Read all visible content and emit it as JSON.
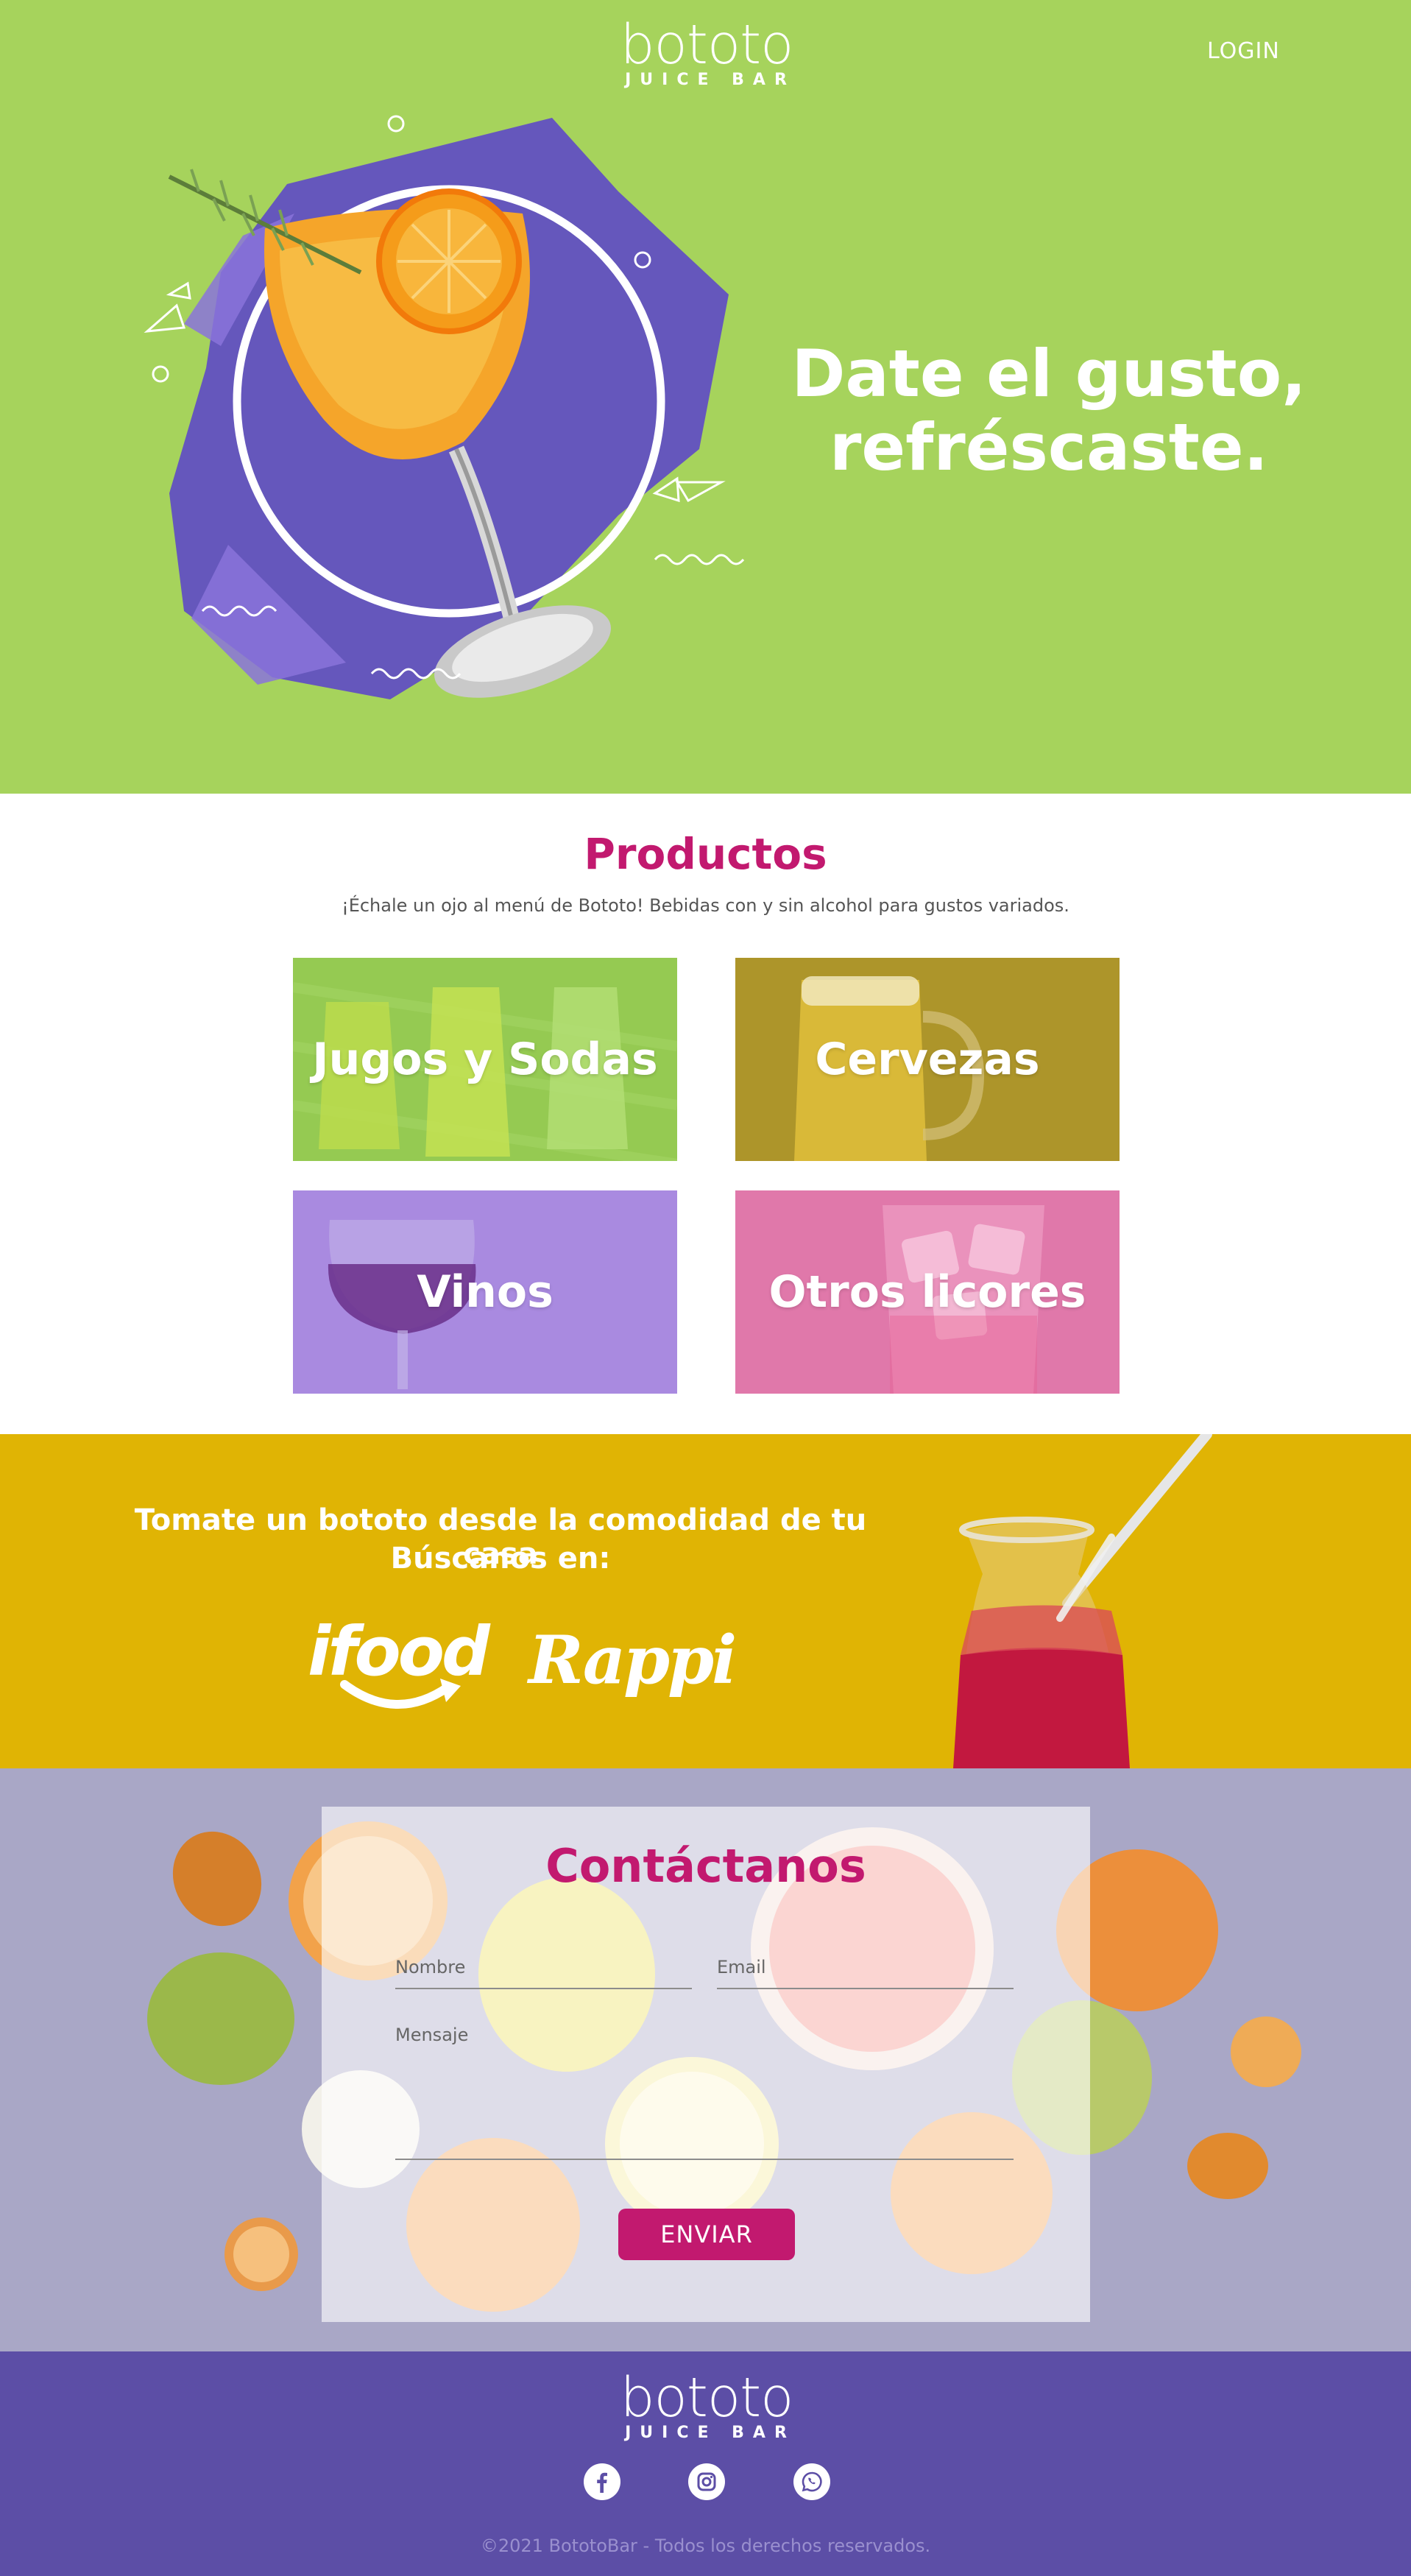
{
  "brand": {
    "name": "bototo",
    "tagline": "JUICE BAR"
  },
  "header": {
    "login_label": "LOGIN"
  },
  "hero": {
    "title_line1": "Date el gusto,",
    "title_line2": "refréscaste."
  },
  "products": {
    "title": "Productos",
    "intro": "¡Échale un ojo al menú de Bototo! Bebidas con y sin alcohol para gustos variados.",
    "items": [
      {
        "label": "Jugos y Sodas",
        "color": "#a6d35c"
      },
      {
        "label": "Cervezas",
        "color": "#b09a2c"
      },
      {
        "label": "Vinos",
        "color": "#a889dd"
      },
      {
        "label": "Otros licores",
        "color": "#e077a8"
      }
    ]
  },
  "delivery": {
    "line1": "Tomate un bototo desde la comodidad de tu casa",
    "line2": "Búscanos en:",
    "platforms": [
      "ifood",
      "Rappi"
    ]
  },
  "contact": {
    "title": "Contáctanos",
    "fields": {
      "name_label": "Nombre",
      "email_label": "Email",
      "message_label": "Mensaje"
    },
    "submit_label": "ENVIAR"
  },
  "footer": {
    "social": [
      "facebook-icon",
      "instagram-icon",
      "whatsapp-icon"
    ],
    "copyright": "©2021 BototoBar - Todos los derechos reservados."
  },
  "colors": {
    "hero_green": "#a6d35c",
    "accent_magenta": "#c2196f",
    "delivery_yellow": "#e0b404",
    "footer_purple": "#5c4ea6"
  }
}
